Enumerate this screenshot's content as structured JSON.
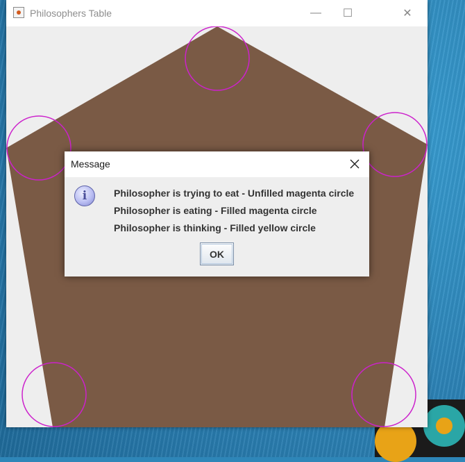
{
  "window": {
    "title": "Philosophers Table",
    "controls": {
      "minimize": "—",
      "maximize": "☐",
      "close": "✕"
    }
  },
  "table": {
    "color": "#7a5a45",
    "background": "#eeeeee",
    "philosophers": [
      {
        "state": "trying to eat",
        "color": "#cc22cc",
        "filled": false
      },
      {
        "state": "trying to eat",
        "color": "#cc22cc",
        "filled": false
      },
      {
        "state": "trying to eat",
        "color": "#cc22cc",
        "filled": false
      },
      {
        "state": "trying to eat",
        "color": "#cc22cc",
        "filled": false
      },
      {
        "state": "trying to eat",
        "color": "#cc22cc",
        "filled": false
      }
    ]
  },
  "dialog": {
    "title": "Message",
    "icon": "info-icon",
    "icon_glyph": "i",
    "lines": [
      "Philosopher is trying to eat - Unfilled magenta circle",
      "Philosopher is eating - Filled magenta circle",
      "Philosopher is thinking - Filled yellow circle"
    ],
    "ok_label": "OK"
  }
}
